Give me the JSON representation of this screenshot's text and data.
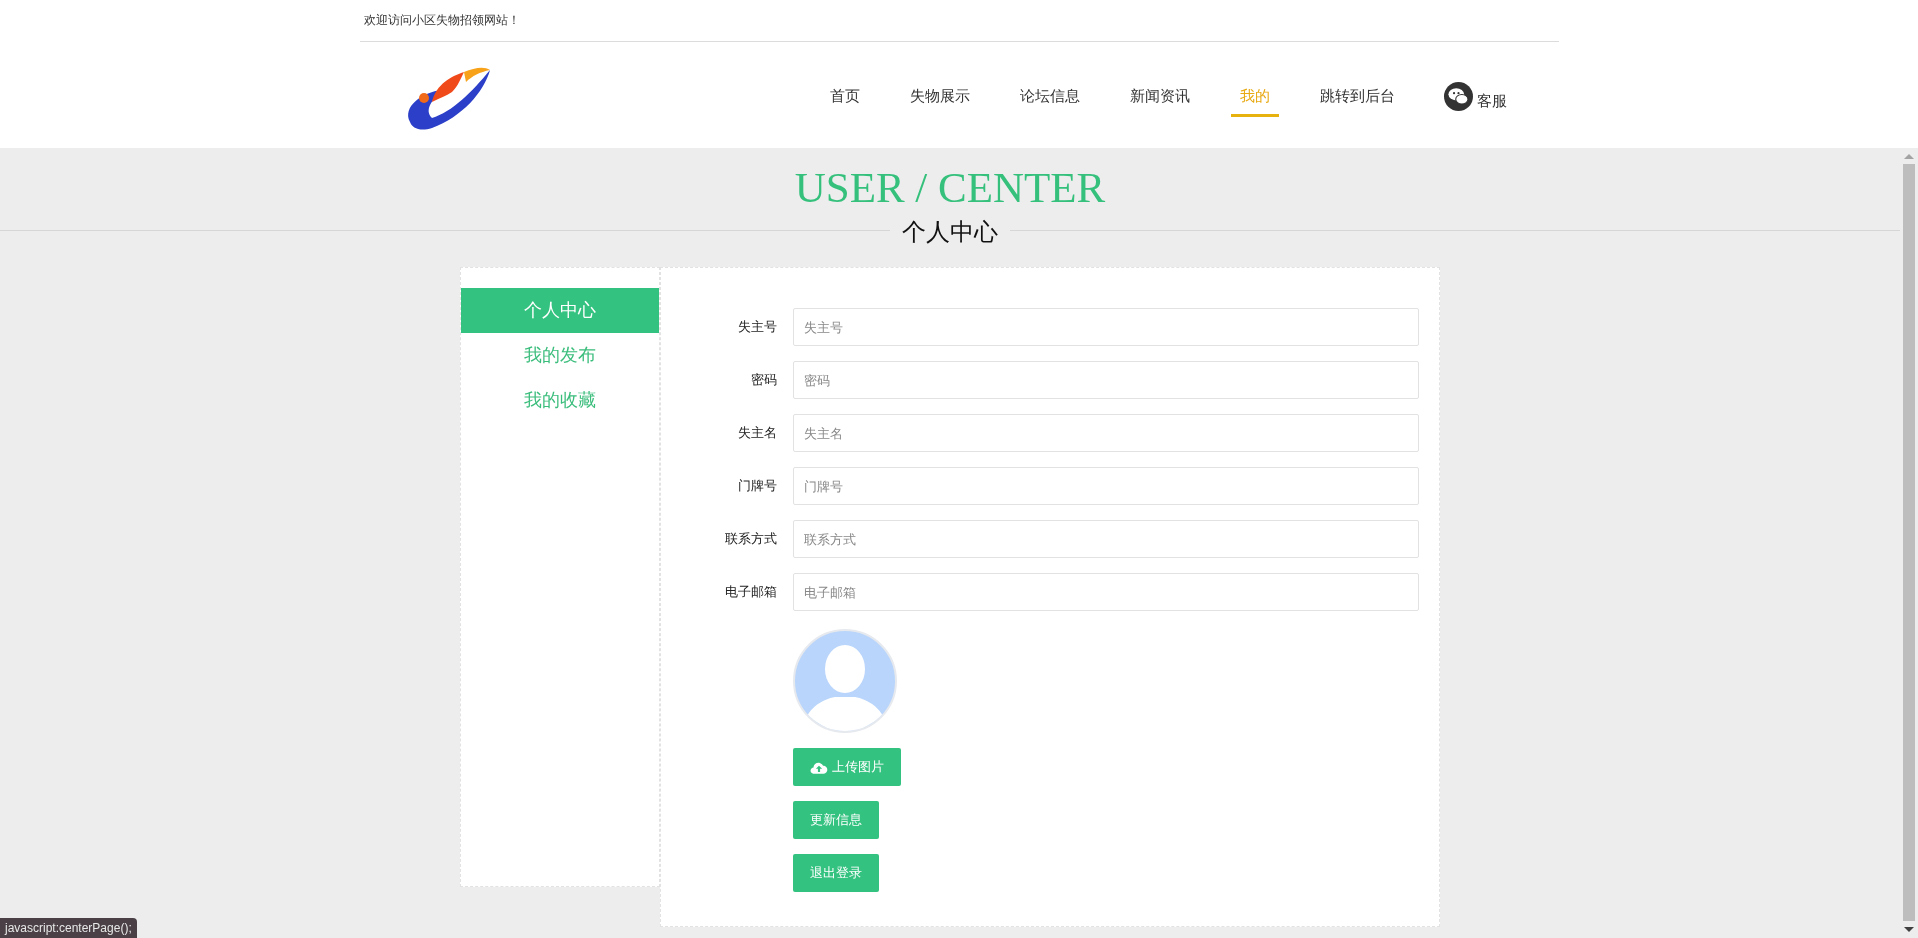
{
  "top_bar": {
    "welcome": "欢迎访问小区失物招领网站！"
  },
  "nav": [
    {
      "label": "首页",
      "kind": "link",
      "selected": false
    },
    {
      "label": "失物展示",
      "kind": "link",
      "selected": false
    },
    {
      "label": "论坛信息",
      "kind": "link",
      "selected": false
    },
    {
      "label": "新闻资讯",
      "kind": "link",
      "selected": false
    },
    {
      "label": "我的",
      "kind": "link",
      "selected": true
    },
    {
      "label": "跳转到后台",
      "kind": "link",
      "selected": false
    },
    {
      "label": "客服",
      "kind": "service",
      "selected": false
    }
  ],
  "page_title": {
    "english": "USER / CENTER",
    "chinese": "个人中心"
  },
  "sidebar": {
    "items": [
      {
        "label": "个人中心",
        "selected": true
      },
      {
        "label": "我的发布",
        "selected": false
      },
      {
        "label": "我的收藏",
        "selected": false
      }
    ]
  },
  "form": {
    "fields": [
      {
        "label": "失主号",
        "placeholder": "失主号"
      },
      {
        "label": "密码",
        "placeholder": "密码"
      },
      {
        "label": "失主名",
        "placeholder": "失主名"
      },
      {
        "label": "门牌号",
        "placeholder": "门牌号"
      },
      {
        "label": "联系方式",
        "placeholder": "联系方式"
      },
      {
        "label": "电子邮箱",
        "placeholder": "电子邮箱"
      }
    ],
    "buttons": [
      {
        "label": "上传图片",
        "kind": "upload"
      },
      {
        "label": "更新信息",
        "kind": "plain"
      },
      {
        "label": "退出登录",
        "kind": "plain"
      }
    ]
  },
  "status_tooltip": "javascript:centerPage();"
}
